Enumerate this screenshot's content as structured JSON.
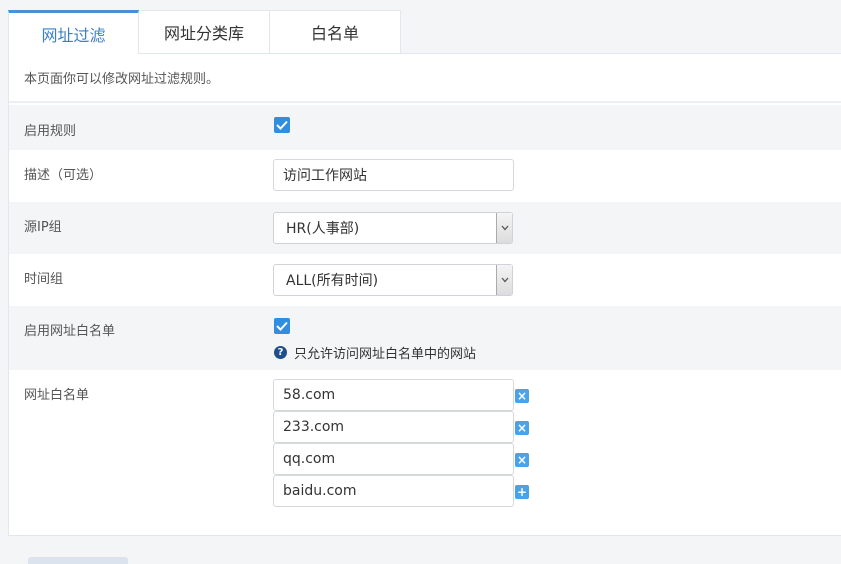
{
  "tabs": [
    {
      "label": "网址过滤",
      "active": true
    },
    {
      "label": "网址分类库",
      "active": false
    },
    {
      "label": "白名单",
      "active": false
    }
  ],
  "description": "本页面你可以修改网址过滤规则。",
  "form": {
    "enable_rule": {
      "label": "启用规则",
      "checked": true
    },
    "desc_optional": {
      "label": "描述（可选）",
      "value": "访问工作网站"
    },
    "source_ip_group": {
      "label": "源IP组",
      "selected": "HR(人事部)"
    },
    "time_group": {
      "label": "时间组",
      "selected": "ALL(所有时间)"
    },
    "enable_whitelist": {
      "label": "启用网址白名单",
      "checked": true,
      "hint": "只允许访问网址白名单中的网站"
    },
    "whitelist": {
      "label": "网址白名单",
      "entries": [
        "58.com",
        "233.com",
        "qq.com",
        "baidu.com"
      ]
    }
  },
  "icons": {
    "check": "check-icon",
    "help": "question-circle-icon",
    "remove": "close-icon",
    "add": "plus-icon",
    "dropdown": "chevron-down-icon"
  },
  "colors": {
    "accent": "#4a90d6",
    "checkbox": "#2f8ee0",
    "entry_button": "#4aa3e8"
  }
}
